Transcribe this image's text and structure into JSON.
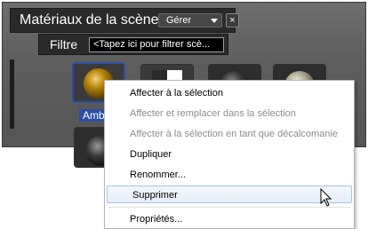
{
  "panel": {
    "title": "Matériaux de la scène",
    "gerer_label": "Gérer",
    "close_label": "×",
    "filter_label": "Filtre",
    "filter_placeholder": "<Tapez ici pour filtrer scè..."
  },
  "materials": [
    {
      "label": "Amb",
      "selected": true,
      "icon": "gold-sphere"
    },
    {
      "label": "",
      "selected": false,
      "icon": "split-swatch"
    },
    {
      "label": "",
      "selected": false,
      "icon": "dark-sphere"
    },
    {
      "label": "",
      "selected": false,
      "icon": "grey-sphere"
    },
    {
      "label": "",
      "selected": false,
      "icon": "dark-sphere"
    }
  ],
  "context_menu": {
    "items": [
      {
        "label": "Affecter à la sélection",
        "enabled": true
      },
      {
        "label": "Affecter et remplacer dans la sélection",
        "enabled": false
      },
      {
        "label": "Affecter à la sélection en tant que décalcomanie",
        "enabled": false
      },
      {
        "label": "Dupliquer",
        "enabled": true
      },
      {
        "label": "Renommer...",
        "enabled": true
      },
      {
        "label": "Supprimer",
        "enabled": true,
        "hover": true
      },
      {
        "label": "Propriétés...",
        "enabled": true
      }
    ]
  }
}
